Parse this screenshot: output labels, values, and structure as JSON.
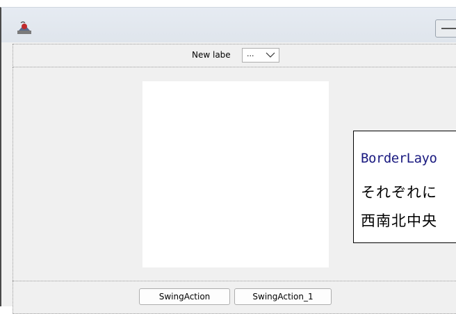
{
  "window": {
    "app_icon": "java-cup-icon",
    "title_button_icon": "minimize-icon"
  },
  "north": {
    "label": "New labe",
    "combo_value": "...",
    "combo_icon": "chevron-down-icon"
  },
  "south": {
    "button1_label": "SwingAction",
    "button2_label": "SwingAction_1"
  },
  "callout": {
    "title": "BorderLayo",
    "line1": "それぞれに",
    "line2": "西南北中央"
  },
  "colors": {
    "window_bg": "#f0f0f0",
    "center_panel": "#ffffff",
    "callout_title": "#1a1a80"
  }
}
